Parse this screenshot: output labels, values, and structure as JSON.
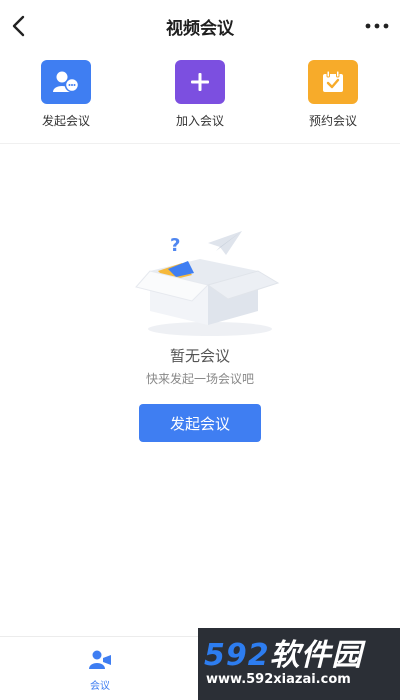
{
  "header": {
    "title": "视频会议",
    "back_icon": "chevron-left-icon",
    "more_icon": "more-horizontal-icon"
  },
  "actions": [
    {
      "label": "发起会议",
      "icon": "start-meeting-icon",
      "color": "#3f7ef2"
    },
    {
      "label": "加入会议",
      "icon": "plus-icon",
      "color": "#7c4fe0"
    },
    {
      "label": "预约会议",
      "icon": "calendar-check-icon",
      "color": "#f7ab2a"
    }
  ],
  "empty_state": {
    "illustration": "empty-box-illustration",
    "title": "暂无会议",
    "subtitle": "快来发起一场会议吧",
    "button_label": "发起会议"
  },
  "bottom_nav": {
    "items": [
      {
        "label": "会议",
        "icon": "meeting-icon",
        "active": true
      }
    ],
    "accent_color": "#3f7ef2"
  },
  "watermark": {
    "brand_num": "592",
    "brand_text": "软件园",
    "url": "www.592xiazai.com"
  }
}
